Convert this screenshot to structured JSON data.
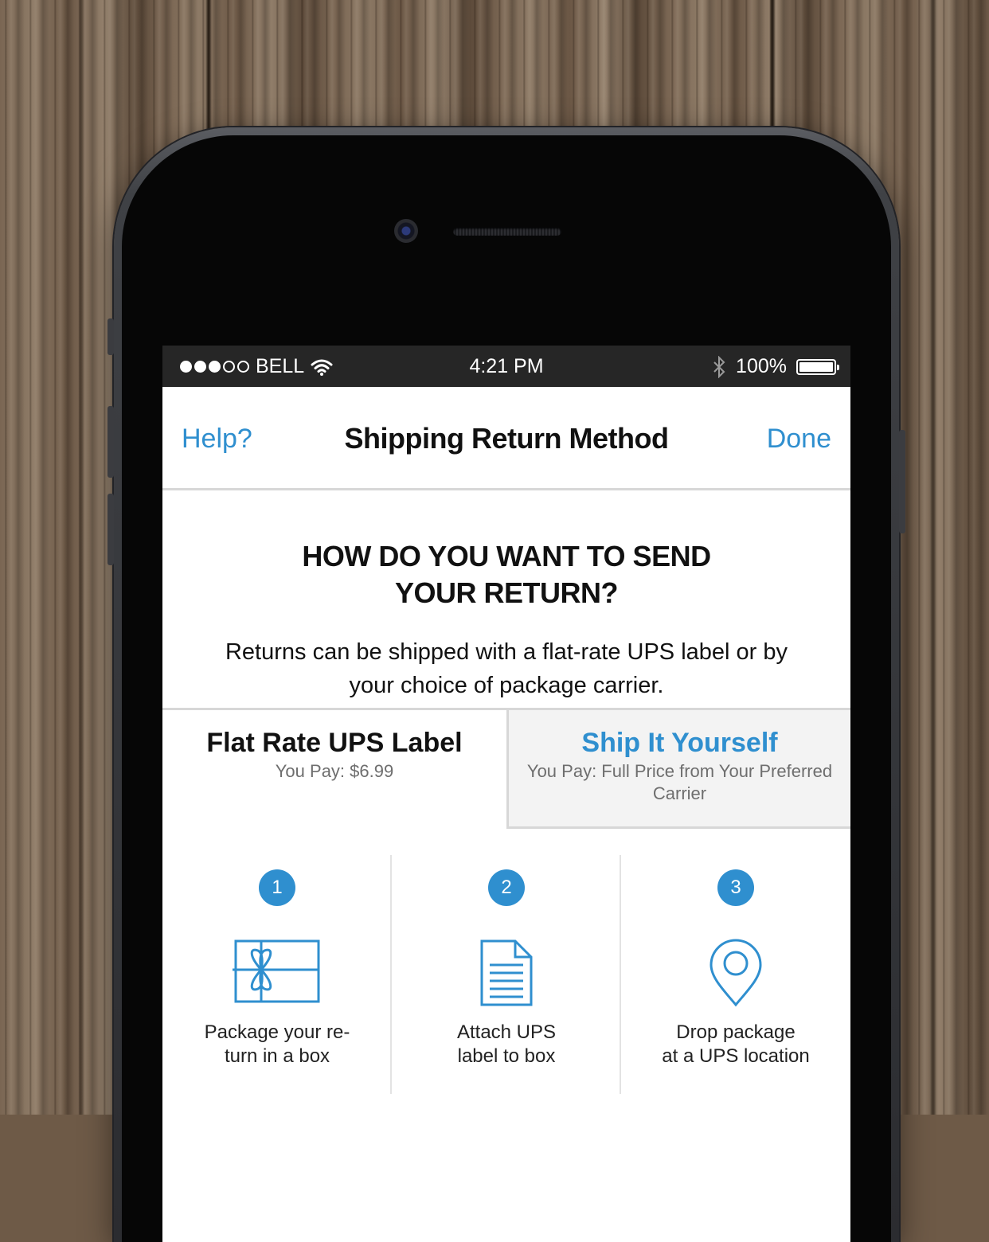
{
  "status_bar": {
    "carrier": "BELL",
    "time": "4:21 PM",
    "battery": "100%",
    "signal_bars_filled": 3,
    "signal_bars_total": 5
  },
  "nav": {
    "help_label": "Help?",
    "title": "Shipping Return Method",
    "done_label": "Done"
  },
  "intro": {
    "heading_line1": "HOW DO YOU WANT TO SEND",
    "heading_line2": "YOUR RETURN?",
    "description": "Returns can be shipped with a flat-rate UPS label or by your choice of package carrier."
  },
  "options": [
    {
      "name": "Flat Rate UPS Label",
      "price": "You Pay: $6.99"
    },
    {
      "name": "Ship It Yourself",
      "price": "You Pay: Full Price from Your Preferred Carrier"
    }
  ],
  "steps": [
    {
      "number": "1",
      "icon": "gift-box-icon",
      "caption_line1": "Package your re-",
      "caption_line2": "turn in a box"
    },
    {
      "number": "2",
      "icon": "document-label-icon",
      "caption_line1": "Attach UPS",
      "caption_line2": "label to box"
    },
    {
      "number": "3",
      "icon": "map-pin-icon",
      "caption_line1": "Drop package",
      "caption_line2": "at a UPS location"
    }
  ],
  "colors": {
    "accent": "#2f8fcf",
    "status_bar_bg": "#262626",
    "selected_tab_bg": "#f3f3f3"
  }
}
